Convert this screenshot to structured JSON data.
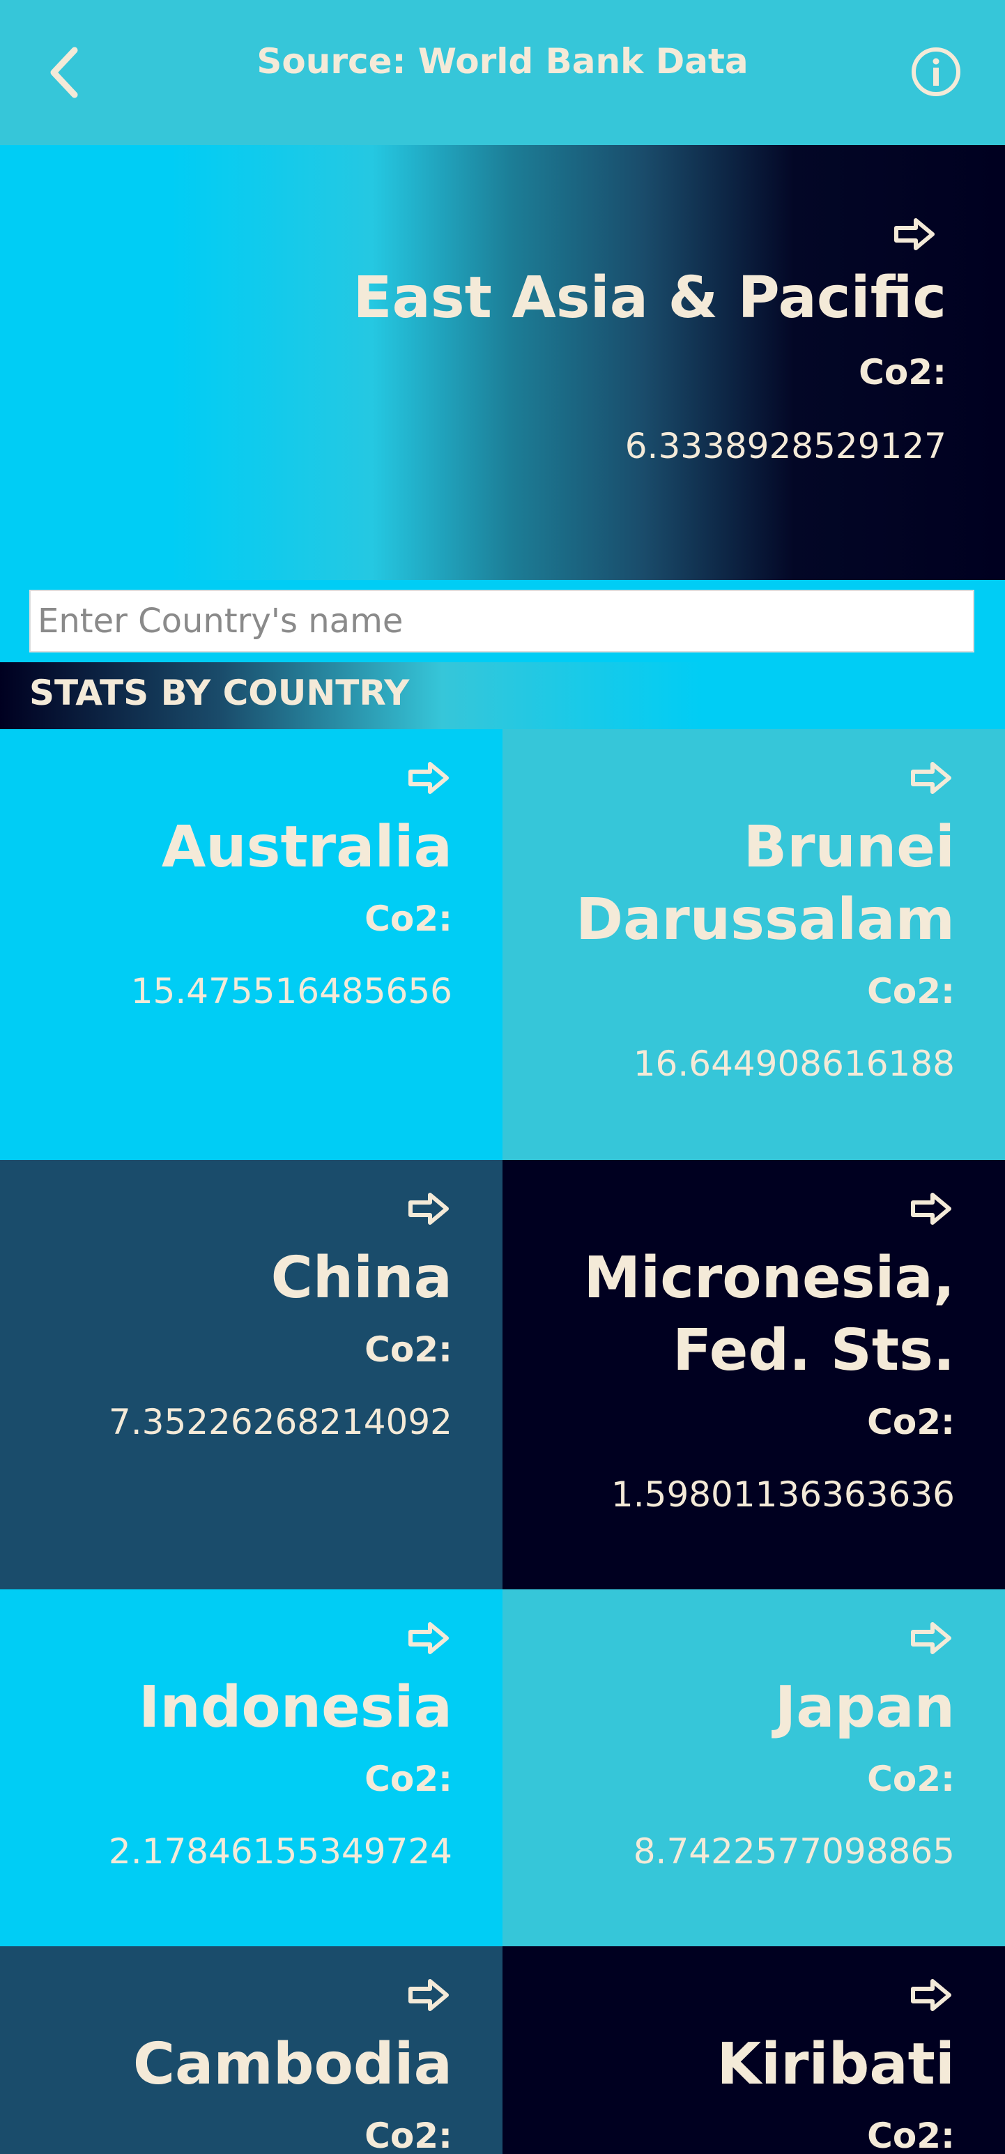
{
  "header": {
    "title": "Source: World Bank Data",
    "back_icon": "chevron-left-icon",
    "info_icon": "info-circle-icon"
  },
  "region": {
    "name": "East Asia & Pacific",
    "co2_label": "Co2:",
    "co2_value": "6.3338928529127"
  },
  "search": {
    "placeholder": "Enter Country's name",
    "value": ""
  },
  "section": {
    "title": "STATS BY COUNTRY"
  },
  "countries": [
    {
      "name": "Australia",
      "co2_label": "Co2:",
      "co2_value": "15.475516485656"
    },
    {
      "name": "Brunei Darussalam",
      "co2_label": "Co2:",
      "co2_value": "16.644908616188"
    },
    {
      "name": "China",
      "co2_label": "Co2:",
      "co2_value": "7.35226268214092"
    },
    {
      "name": "Micronesia, Fed. Sts.",
      "co2_label": "Co2:",
      "co2_value": "1.59801136363636"
    },
    {
      "name": "Indonesia",
      "co2_label": "Co2:",
      "co2_value": "2.17846155349724"
    },
    {
      "name": "Japan",
      "co2_label": "Co2:",
      "co2_value": "8.7422577098865"
    },
    {
      "name": "Cambodia",
      "co2_label": "Co2:",
      "co2_value": ""
    },
    {
      "name": "Kiribati",
      "co2_label": "Co2:",
      "co2_value": ""
    }
  ],
  "colors": {
    "topbar": "#36c6d9",
    "tile_bright_cyan": "#00cdf5",
    "tile_cyan": "#36c6d9",
    "tile_navy": "#1a4c6b",
    "tile_dark": "#000020",
    "text": "#f4ead8"
  }
}
